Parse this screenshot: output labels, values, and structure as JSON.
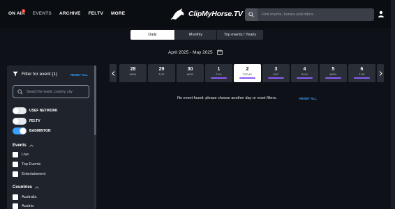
{
  "nav": {
    "items": [
      {
        "label": "ON AIR",
        "badge": "4"
      },
      {
        "label": "EVENTS"
      },
      {
        "label": "ARCHIVE"
      },
      {
        "label": "FEI.TV"
      },
      {
        "label": "MORE"
      }
    ]
  },
  "logo": {
    "text": "ClipMyHorse.TV"
  },
  "search": {
    "placeholder": "Find events, horses and riders"
  },
  "view_toggle": {
    "daily": "Daily",
    "monthly": "Monthly",
    "yearly": "Top events / Yearly"
  },
  "date_range": "April 2025 - May 2025",
  "days": [
    {
      "num": "28",
      "dow": "MON"
    },
    {
      "num": "29",
      "dow": "TUE"
    },
    {
      "num": "30",
      "dow": "WED"
    },
    {
      "num": "1",
      "dow": "THU"
    },
    {
      "num": "2",
      "dow": "TODAY"
    },
    {
      "num": "3",
      "dow": "SAT"
    },
    {
      "num": "4",
      "dow": "SUN"
    },
    {
      "num": "5",
      "dow": "MON"
    },
    {
      "num": "6",
      "dow": "TUE"
    }
  ],
  "no_event_text": "No event found: please choose another day or reset filters.",
  "reset_all": "RESET ALL",
  "sidebar": {
    "title": "Filter for event (1)",
    "reset": "RESET ALL",
    "search_placeholder": "Search for event, country, city",
    "toggles": [
      {
        "label": "USEF NETWORK",
        "on": false
      },
      {
        "label": "FEI.TV",
        "on": false
      },
      {
        "label": "BADMINTON",
        "on": true
      }
    ],
    "events_title": "Events",
    "events": [
      "Live",
      "Top Events",
      "Entertainment"
    ],
    "countries_title": "Countries",
    "countries": [
      "Australia",
      "Austria"
    ]
  },
  "colors": {
    "accent": "#3aa0ff",
    "bar": "#8b5cf6",
    "badge": "#d0312d"
  }
}
